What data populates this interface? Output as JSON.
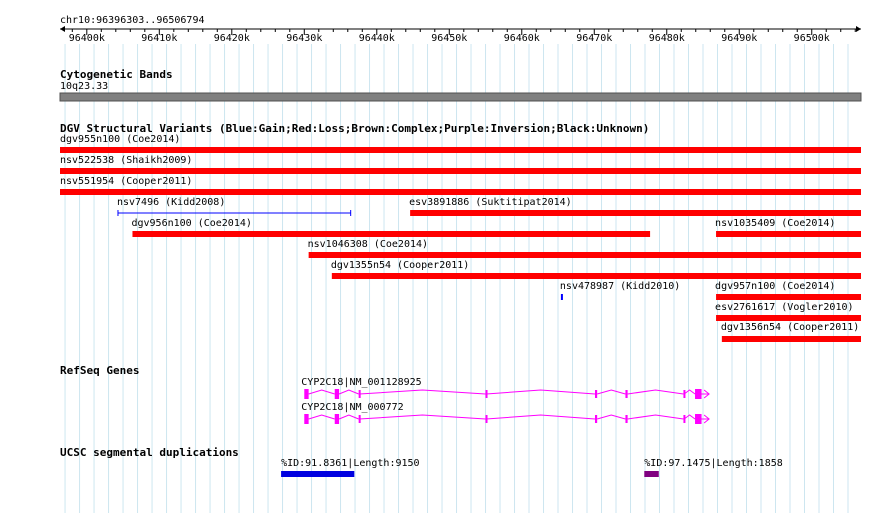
{
  "locus": "chr10:96396303..96506794",
  "ruler": {
    "ticks": [
      "96400k",
      "96410k",
      "96420k",
      "96430k",
      "96440k",
      "96450k",
      "96460k",
      "96470k",
      "96480k",
      "96490k",
      "96500k"
    ],
    "tick_values": [
      96400000,
      96410000,
      96420000,
      96430000,
      96440000,
      96450000,
      96460000,
      96470000,
      96480000,
      96490000,
      96500000
    ]
  },
  "tracks": {
    "cytoband": {
      "title": "Cytogenetic Bands",
      "band": "10q23.33",
      "color": "#808080"
    },
    "dgv": {
      "title": "DGV Structural Variants (Blue:Gain;Red:Loss;Brown:Complex;Purple:Inversion;Black:Unknown)",
      "colors": {
        "loss": "#ff0000",
        "gain": "#0000ff"
      },
      "features": [
        {
          "label": "dgv955n100 (Coe2014)",
          "type": "loss",
          "start": 96391000,
          "end": 96520000
        },
        {
          "label": "nsv522538 (Shaikh2009)",
          "type": "loss",
          "start": 96391000,
          "end": 96520000
        },
        {
          "label": "nsv551954 (Cooper2011)",
          "type": "loss",
          "start": 96391000,
          "end": 96520000
        },
        {
          "label": "nsv7496 (Kidd2008)",
          "type": "gain",
          "start": 96404300,
          "end": 96436400
        },
        {
          "label": "esv3891886 (Suktitipat2014)",
          "type": "loss",
          "start": 96444600,
          "end": 96520000
        },
        {
          "label": "dgv956n100 (Coe2014)",
          "type": "loss",
          "start": 96406300,
          "end": 96477700
        },
        {
          "label": "nsv1035409 (Coe2014)",
          "type": "loss",
          "start": 96486800,
          "end": 96520000
        },
        {
          "label": "nsv1046308 (Coe2014)",
          "type": "loss",
          "start": 96430600,
          "end": 96520000
        },
        {
          "label": "dgv1355n54 (Cooper2011)",
          "type": "loss",
          "start": 96433800,
          "end": 96520000
        },
        {
          "label": "nsv478987 (Kidd2010)",
          "type": "gain",
          "start": 96465400,
          "end": 96465600
        },
        {
          "label": "dgv957n100 (Coe2014)",
          "type": "loss",
          "start": 96486800,
          "end": 96520000
        },
        {
          "label": "esv2761617 (Vogler2010)",
          "type": "loss",
          "start": 96486800,
          "end": 96520000
        },
        {
          "label": "dgv1356n54 (Cooper2011)",
          "type": "loss",
          "start": 96487600,
          "end": 96520000
        }
      ]
    },
    "refseq": {
      "title": "RefSeq Genes",
      "color": "#ff00ff",
      "genes": [
        {
          "label": "CYP2C18|NM_001128925",
          "start": 96430000,
          "end": 96484600,
          "exons": [
            [
              96430000,
              96430600
            ],
            [
              96434200,
              96434800
            ],
            [
              96437500,
              96437600
            ],
            [
              96455000,
              96455100
            ],
            [
              96470100,
              96470400
            ],
            [
              96474300,
              96474600
            ],
            [
              96482300,
              96482400
            ],
            [
              96483900,
              96484800
            ]
          ]
        },
        {
          "label": "CYP2C18|NM_000772",
          "start": 96430000,
          "end": 96484600,
          "exons": [
            [
              96430000,
              96430600
            ],
            [
              96434200,
              96434800
            ],
            [
              96437500,
              96437600
            ],
            [
              96455000,
              96455100
            ],
            [
              96470100,
              96470400
            ],
            [
              96474300,
              96474600
            ],
            [
              96482300,
              96482400
            ],
            [
              96483900,
              96484800
            ]
          ]
        }
      ]
    },
    "segdups": {
      "title": "UCSC segmental duplications",
      "features": [
        {
          "label": "%ID:91.8361|Length:9150",
          "start": 96426800,
          "end": 96436900,
          "color": "#0000e0"
        },
        {
          "label": "%ID:97.1475|Length:1858",
          "start": 96476900,
          "end": 96478900,
          "color": "#800080"
        }
      ]
    }
  }
}
